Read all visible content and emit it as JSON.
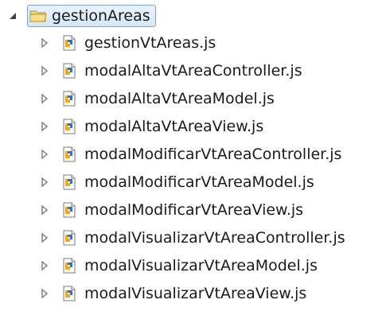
{
  "tree": {
    "folder": {
      "name": "gestionAreas",
      "icon": "folder-icon",
      "expanded": true
    },
    "files": [
      {
        "name": "gestionVtAreas.js",
        "icon": "js-file-icon"
      },
      {
        "name": "modalAltaVtAreaController.js",
        "icon": "js-file-icon"
      },
      {
        "name": "modalAltaVtAreaModel.js",
        "icon": "js-file-icon"
      },
      {
        "name": "modalAltaVtAreaView.js",
        "icon": "js-file-icon"
      },
      {
        "name": "modalModificarVtAreaController.js",
        "icon": "js-file-icon"
      },
      {
        "name": "modalModificarVtAreaModel.js",
        "icon": "js-file-icon"
      },
      {
        "name": "modalModificarVtAreaView.js",
        "icon": "js-file-icon"
      },
      {
        "name": "modalVisualizarVtAreaController.js",
        "icon": "js-file-icon"
      },
      {
        "name": "modalVisualizarVtAreaModel.js",
        "icon": "js-file-icon"
      },
      {
        "name": "modalVisualizarVtAreaView.js",
        "icon": "js-file-icon"
      }
    ]
  },
  "colors": {
    "selection_border": "#7da2ce",
    "selection_fill": "#d9e8fb",
    "twisty": "#595959",
    "folder": "#e8c35b",
    "js_file_accent": "#e2a21a",
    "js_file_blue": "#3b6fb6"
  }
}
